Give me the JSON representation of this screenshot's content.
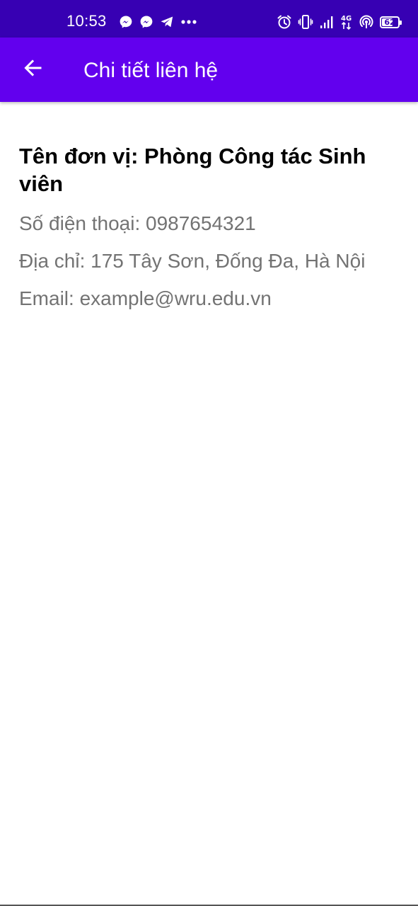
{
  "status_bar": {
    "time": "10:53",
    "battery_level": "62",
    "network_label": "4G",
    "notification_icons": [
      "messenger-icon",
      "messenger-icon",
      "telegram-icon",
      "more-dots-icon"
    ],
    "system_icons": [
      "alarm-icon",
      "vibrate-icon",
      "signal-icon",
      "4g-icon",
      "hotspot-icon",
      "battery-icon"
    ]
  },
  "app_bar": {
    "title": "Chi tiết liên hệ",
    "back_icon": "arrow-back-icon",
    "background": "#6200ee"
  },
  "contact": {
    "unit_name": "Tên đơn vị: Phòng Công tác Sinh viên",
    "phone": "Số điện thoại: 0987654321",
    "address": "Địa chỉ: 175 Tây Sơn, Đống Đa, Hà Nội",
    "email": "Email: example@wru.edu.vn"
  },
  "colors": {
    "status_bar": "#3700b3",
    "app_bar": "#6200ee",
    "primary_text": "#000000",
    "secondary_text": "#737373"
  }
}
